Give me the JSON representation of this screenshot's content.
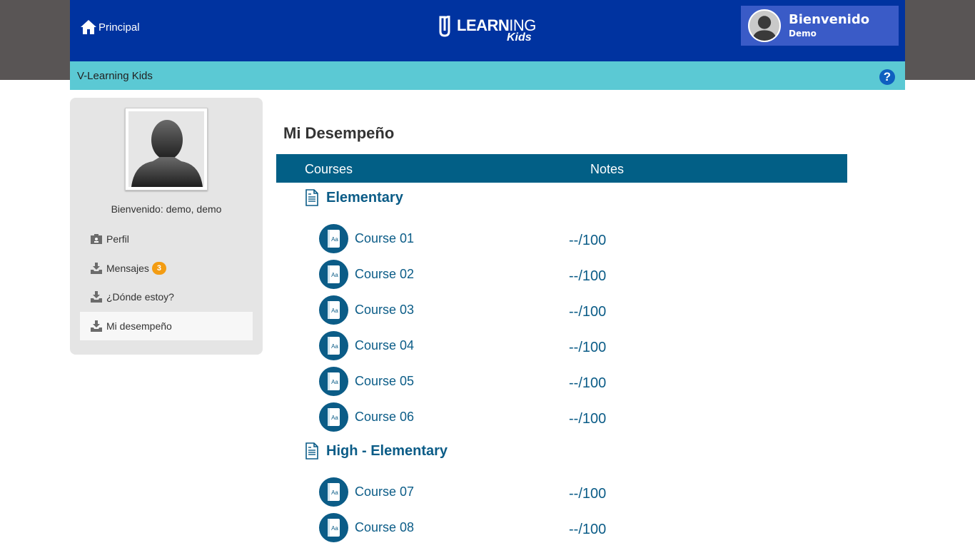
{
  "header": {
    "home_label": "Principal",
    "logo_word_bold": "LEARN",
    "logo_word_thin": "ING",
    "logo_sub": "Kids",
    "welcome_title": "Bienvenido",
    "welcome_user": "Demo"
  },
  "subbar": {
    "title": "V-Learning Kids",
    "help": "?"
  },
  "sidebar": {
    "greeting": "Bienvenido: demo, demo",
    "menu": [
      {
        "label": "Perfil",
        "icon": "id-card-icon"
      },
      {
        "label": "Mensajes",
        "icon": "inbox-icon",
        "badge": "3"
      },
      {
        "label": "¿Dónde estoy?",
        "icon": "inbox-icon"
      },
      {
        "label": "Mi desempeño",
        "icon": "inbox-icon",
        "active": true
      }
    ]
  },
  "main": {
    "title": "Mi Desempeño",
    "columns": [
      "Courses",
      "Notes"
    ],
    "levels": [
      {
        "name": "Elementary",
        "courses": [
          {
            "name": "Course 01",
            "note": "--/100"
          },
          {
            "name": "Course 02",
            "note": "--/100"
          },
          {
            "name": "Course 03",
            "note": "--/100"
          },
          {
            "name": "Course 04",
            "note": "--/100"
          },
          {
            "name": "Course 05",
            "note": "--/100"
          },
          {
            "name": "Course 06",
            "note": "--/100"
          }
        ]
      },
      {
        "name": "High - Elementary",
        "courses": [
          {
            "name": "Course 07",
            "note": "--/100"
          },
          {
            "name": "Course 08",
            "note": "--/100"
          }
        ]
      }
    ]
  },
  "colors": {
    "header_blue": "#0033a0",
    "subbar_teal": "#5bc9d4",
    "table_header": "#025f86",
    "accent_text": "#0b5c87",
    "badge_orange": "#f39c12"
  }
}
